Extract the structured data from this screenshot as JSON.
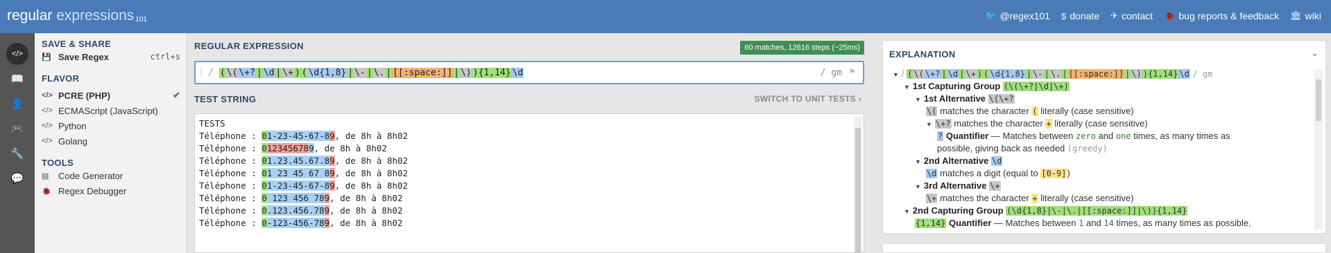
{
  "header": {
    "logo_a": "regular",
    "logo_b": " expressions",
    "logo_ver": "101",
    "nav": [
      {
        "icon": "twitter-icon",
        "glyph": "🐦",
        "label": "@regex101"
      },
      {
        "icon": "dollar-icon",
        "glyph": "$",
        "label": "donate"
      },
      {
        "icon": "paper-plane-icon",
        "glyph": "✈",
        "label": "contact"
      },
      {
        "icon": "bug-icon",
        "glyph": "🐞",
        "label": "bug reports & feedback"
      },
      {
        "icon": "library-icon",
        "glyph": "🏛",
        "label": "wiki"
      }
    ]
  },
  "rail": [
    {
      "name": "regex-editor-icon",
      "glyph": "</>"
    },
    {
      "name": "library-book-icon",
      "glyph": "📖"
    },
    {
      "name": "account-icon",
      "glyph": "👤"
    },
    {
      "name": "quiz-icon",
      "glyph": "🎮"
    },
    {
      "name": "settings-wrench-icon",
      "glyph": "🔧"
    },
    {
      "name": "chat-icon",
      "glyph": "💬"
    }
  ],
  "left": {
    "save_title": "SAVE & SHARE",
    "save_label": "Save Regex",
    "save_shortcut": "ctrl+s",
    "flavor_title": "FLAVOR",
    "flavors": [
      "PCRE (PHP)",
      "ECMAScript (JavaScript)",
      "Python",
      "Golang"
    ],
    "tools_title": "TOOLS",
    "tools": [
      "Code Generator",
      "Regex Debugger"
    ]
  },
  "regex": {
    "title": "REGULAR EXPRESSION",
    "badge": "60 matches, 12616 steps (~25ms)",
    "delimiter": "/",
    "flags": "/ gm",
    "tokens": [
      {
        "t": "(",
        "c": "g"
      },
      {
        "t": "\\(",
        "c": "gr"
      },
      {
        "t": "\\+?",
        "c": "b"
      },
      {
        "t": "|",
        "c": "g"
      },
      {
        "t": "\\d",
        "c": "b"
      },
      {
        "t": "|",
        "c": "g"
      },
      {
        "t": "\\+",
        "c": "gr"
      },
      {
        "t": ")",
        "c": "g"
      },
      {
        "t": "(",
        "c": "g"
      },
      {
        "t": "\\d{1,8}",
        "c": "b"
      },
      {
        "t": "|",
        "c": "g"
      },
      {
        "t": "\\-",
        "c": "gr"
      },
      {
        "t": "|",
        "c": "g"
      },
      {
        "t": "\\.",
        "c": "gr"
      },
      {
        "t": "|",
        "c": "g"
      },
      {
        "t": "[[:space:]]",
        "c": "o"
      },
      {
        "t": "|",
        "c": "g"
      },
      {
        "t": "\\)",
        "c": "gr"
      },
      {
        "t": "){1,14}",
        "c": "g"
      },
      {
        "t": "\\d",
        "c": "b"
      }
    ]
  },
  "test": {
    "title": "TEST STRING",
    "switch_label": "SWITCH TO UNIT TESTS",
    "lines": [
      {
        "pre": "TESTS",
        "m": [],
        "post": ""
      },
      {
        "pre": "Téléphone : ",
        "m": [
          [
            "0",
            "hlg"
          ],
          [
            "1-23-45-67-8",
            "hlb"
          ],
          [
            "9",
            "hlr"
          ]
        ],
        "post": ", de 8h à 8h02"
      },
      {
        "pre": "Téléphone : ",
        "m": [
          [
            "0",
            "hlg"
          ],
          [
            "12345678",
            "hlr"
          ],
          [
            "9",
            "hlb"
          ]
        ],
        "post": ", de 8h à 8h02"
      },
      {
        "pre": "Téléphone : ",
        "m": [
          [
            "0",
            "hlg"
          ],
          [
            "1.23.45.67.8",
            "hlb"
          ],
          [
            "9",
            "hlr"
          ]
        ],
        "post": ", de 8h à 8h02"
      },
      {
        "pre": "Téléphone : ",
        "m": [
          [
            "0",
            "hlg"
          ],
          [
            "1 23 45 67 8",
            "hlb"
          ],
          [
            "9",
            "hlr"
          ]
        ],
        "post": ", de 8h à 8h02"
      },
      {
        "pre": "Téléphone : ",
        "m": [
          [
            "0",
            "hlg"
          ],
          [
            "1-23-45-67-8",
            "hlb"
          ],
          [
            "9",
            "hlr"
          ]
        ],
        "post": ", de 8h à 8h02"
      },
      {
        "pre": "Téléphone : ",
        "m": [
          [
            "0",
            "hlg"
          ],
          [
            " 123 456 78",
            "hlb"
          ],
          [
            "9",
            "hlr"
          ]
        ],
        "post": ", de 8h à 8h02"
      },
      {
        "pre": "Téléphone : ",
        "m": [
          [
            "0",
            "hlg"
          ],
          [
            ".123.456.78",
            "hlb"
          ],
          [
            "9",
            "hlr"
          ]
        ],
        "post": ", de 8h à 8h02"
      },
      {
        "pre": "Téléphone : ",
        "m": [
          [
            "0",
            "hlg"
          ],
          [
            "-123-456-78",
            "hlb"
          ],
          [
            "9",
            "hlr"
          ]
        ],
        "post": ", de 8h à 8h02"
      }
    ]
  },
  "explanation": {
    "title": "EXPLANATION",
    "g1_title": "1st Capturing Group",
    "g1_regex": "(\\(\\+?|\\d|\\+)",
    "alt1_title": "1st Alternative",
    "alt1_regex": "\\(\\+?",
    "alt1_char_tok": "\\(",
    "alt1_char_text": "matches the character",
    "alt1_char_lit": "(",
    "alt1_char_tail": "literally (case sensitive)",
    "alt1_plus_tok": "\\+?",
    "alt1_plus_text": "matches the character",
    "alt1_plus_lit": "+",
    "alt1_plus_tail": "literally (case sensitive)",
    "quant_tok": "?",
    "quant_label": "Quantifier",
    "quant_text_a": "— Matches between",
    "quant_zero": "zero",
    "quant_and": "and",
    "quant_one": "one",
    "quant_text_b": "times, as many times as",
    "quant_text_c": "possible, giving back as needed",
    "quant_greedy": "(greedy)",
    "alt2_title": "2nd Alternative",
    "alt2_regex": "\\d",
    "alt2_text_a": "matches a digit (equal to",
    "alt2_range": "[0-9]",
    "alt2_text_b": ")",
    "alt3_title": "3rd Alternative",
    "alt3_regex": "\\+",
    "alt3_text": "matches the character",
    "alt3_lit": "+",
    "alt3_tail": "literally (case sensitive)",
    "g2_title": "2nd Capturing Group",
    "g2_regex": "(\\d{1,8}|\\-|\\.|[[:space:]]|\\)){1,14}",
    "q2_tok": "{1,14}",
    "q2_label": "Quantifier",
    "q2_text_a": "— Matches between",
    "q2_one": "1",
    "q2_and": "and",
    "q2_fourteen": "14",
    "q2_text_b": "times, as many times as possible,"
  },
  "colors": {
    "header": "#4a7ab8",
    "badge": "#3f8f55",
    "accent": "#6e9bd6"
  }
}
